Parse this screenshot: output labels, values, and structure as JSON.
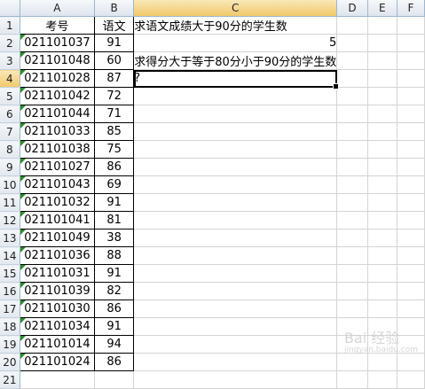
{
  "columns": [
    "A",
    "B",
    "C",
    "D",
    "E",
    "F"
  ],
  "active_column": "C",
  "active_row": "4",
  "header_row": {
    "a": "考号",
    "b": "语文"
  },
  "rows": [
    {
      "num": "1"
    },
    {
      "num": "2",
      "a": "021101037",
      "b": "91"
    },
    {
      "num": "3",
      "a": "021101048",
      "b": "60"
    },
    {
      "num": "4",
      "a": "021101028",
      "b": "87"
    },
    {
      "num": "5",
      "a": "021101042",
      "b": "72"
    },
    {
      "num": "6",
      "a": "021101044",
      "b": "71"
    },
    {
      "num": "7",
      "a": "021101033",
      "b": "85"
    },
    {
      "num": "8",
      "a": "021101038",
      "b": "75"
    },
    {
      "num": "9",
      "a": "021101027",
      "b": "86"
    },
    {
      "num": "10",
      "a": "021101043",
      "b": "69"
    },
    {
      "num": "11",
      "a": "021101032",
      "b": "91"
    },
    {
      "num": "12",
      "a": "021101041",
      "b": "81"
    },
    {
      "num": "13",
      "a": "021101049",
      "b": "38"
    },
    {
      "num": "14",
      "a": "021101036",
      "b": "88"
    },
    {
      "num": "15",
      "a": "021101031",
      "b": "91"
    },
    {
      "num": "16",
      "a": "021101039",
      "b": "82"
    },
    {
      "num": "17",
      "a": "021101030",
      "b": "86"
    },
    {
      "num": "18",
      "a": "021101034",
      "b": "91"
    },
    {
      "num": "19",
      "a": "021101014",
      "b": "94"
    },
    {
      "num": "20",
      "a": "021101024",
      "b": "86"
    },
    {
      "num": "21"
    }
  ],
  "c_cells": {
    "c1": "求语文成绩大于90分的学生数",
    "c2": "5",
    "c3": "求得分大于等于80分小于90分的学生数",
    "c4": "?"
  },
  "watermark": {
    "main": "Bai 经验",
    "sub": "jingyan.baidu.com"
  }
}
